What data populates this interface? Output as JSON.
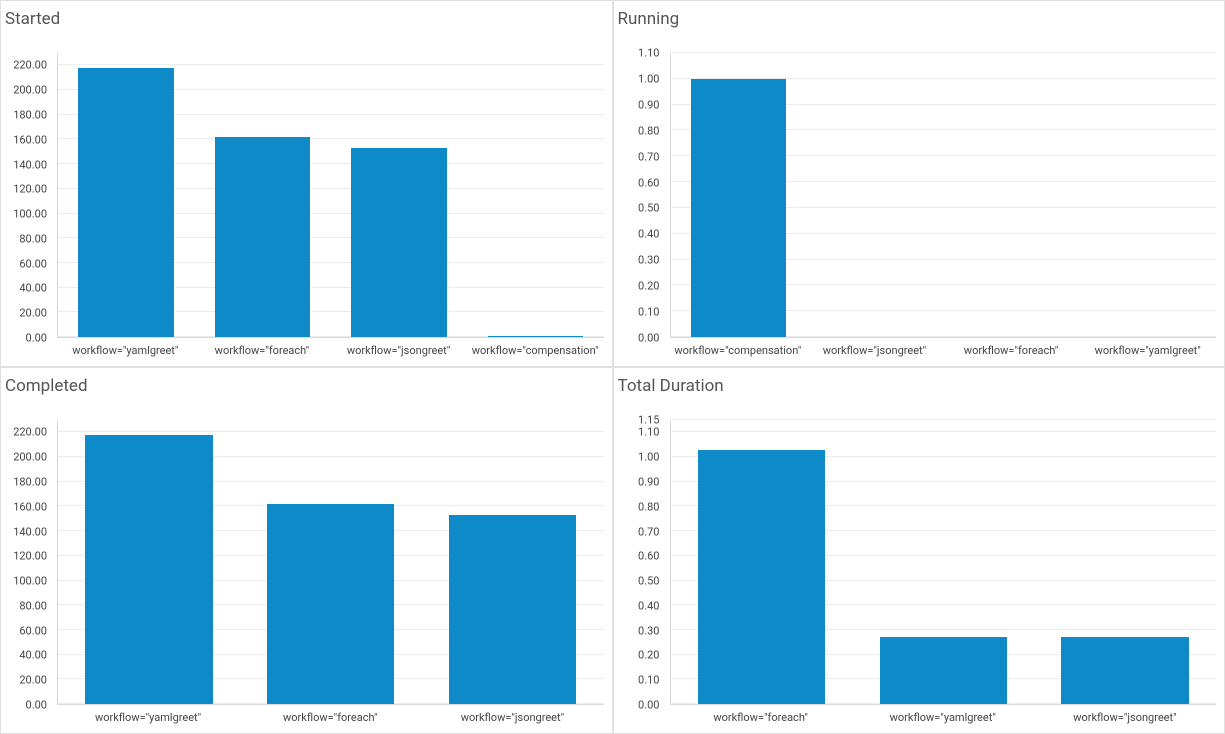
{
  "chart_data": [
    {
      "id": "started",
      "type": "bar",
      "title": "Started",
      "categories": [
        "workflow=\"yamlgreet\"",
        "workflow=\"foreach\"",
        "workflow=\"jsongreet\"",
        "workflow=\"compensation\""
      ],
      "values": [
        218,
        162,
        153,
        1
      ],
      "ylim": [
        0,
        230
      ],
      "yticks": [
        0,
        20,
        40,
        60,
        80,
        100,
        120,
        140,
        160,
        180,
        200,
        220
      ],
      "ytick_labels": [
        "0.00",
        "20.00",
        "40.00",
        "60.00",
        "80.00",
        "100.00",
        "120.00",
        "140.00",
        "160.00",
        "180.00",
        "200.00",
        "220.00"
      ]
    },
    {
      "id": "running",
      "type": "bar",
      "title": "Running",
      "categories": [
        "workflow=\"compensation\"",
        "workflow=\"jsongreet\"",
        "workflow=\"foreach\"",
        "workflow=\"yamlgreet\""
      ],
      "values": [
        1.0,
        0,
        0,
        0
      ],
      "ylim": [
        0,
        1.1
      ],
      "yticks": [
        0,
        0.1,
        0.2,
        0.3,
        0.4,
        0.5,
        0.6,
        0.7,
        0.8,
        0.9,
        1.0,
        1.1
      ],
      "ytick_labels": [
        "0.00",
        "0.10",
        "0.20",
        "0.30",
        "0.40",
        "0.50",
        "0.60",
        "0.70",
        "0.80",
        "0.90",
        "1.00",
        "1.10"
      ]
    },
    {
      "id": "completed",
      "type": "bar",
      "title": "Completed",
      "categories": [
        "workflow=\"yamlgreet\"",
        "workflow=\"foreach\"",
        "workflow=\"jsongreet\""
      ],
      "values": [
        218,
        162,
        153
      ],
      "ylim": [
        0,
        230
      ],
      "yticks": [
        0,
        20,
        40,
        60,
        80,
        100,
        120,
        140,
        160,
        180,
        200,
        220
      ],
      "ytick_labels": [
        "0.00",
        "20.00",
        "40.00",
        "60.00",
        "80.00",
        "100.00",
        "120.00",
        "140.00",
        "160.00",
        "180.00",
        "200.00",
        "220.00"
      ]
    },
    {
      "id": "total_duration",
      "type": "bar",
      "title": "Total Duration",
      "categories": [
        "workflow=\"foreach\"",
        "workflow=\"yamlgreet\"",
        "workflow=\"jsongreet\""
      ],
      "values": [
        1.03,
        0.27,
        0.27
      ],
      "ylim": [
        0,
        1.15
      ],
      "yticks": [
        0,
        0.1,
        0.2,
        0.3,
        0.4,
        0.5,
        0.6,
        0.7,
        0.8,
        0.9,
        1.0,
        1.1,
        1.15
      ],
      "ytick_labels": [
        "0.00",
        "0.10",
        "0.20",
        "0.30",
        "0.40",
        "0.50",
        "0.60",
        "0.70",
        "0.80",
        "0.90",
        "1.00",
        "1.10",
        "1.15"
      ]
    }
  ]
}
